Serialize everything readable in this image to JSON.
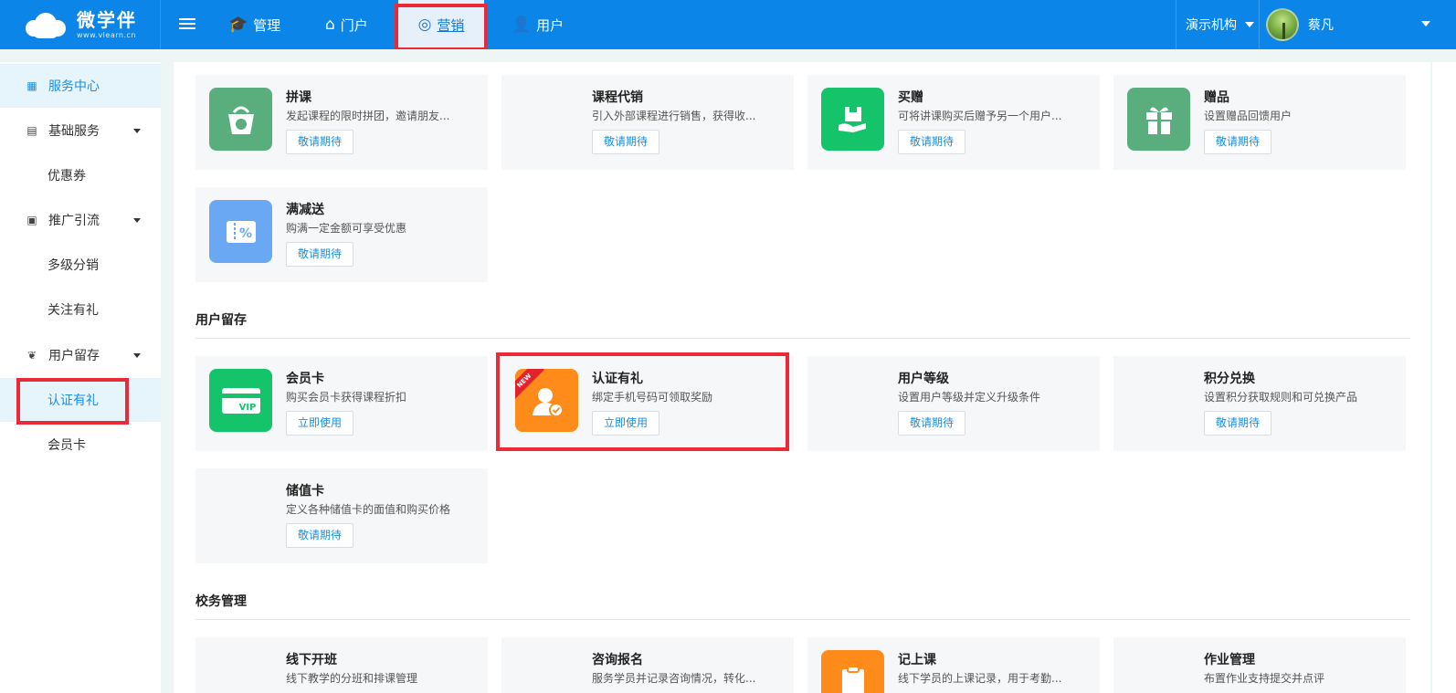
{
  "header": {
    "logo_text": "微学伴",
    "logo_sub": "www.vlearn.cn",
    "nav": [
      {
        "label": "管理",
        "icon": "graduation-cap-icon"
      },
      {
        "label": "门户",
        "icon": "home-icon"
      },
      {
        "label": "营销",
        "icon": "globe-icon",
        "active": true
      },
      {
        "label": "用户",
        "icon": "user-gear-icon"
      }
    ],
    "org": "演示机构",
    "user_name": "蔡凡"
  },
  "sidebar": {
    "items": [
      {
        "label": "服务中心",
        "icon": "grid-icon",
        "active": true
      },
      {
        "label": "基础服务",
        "icon": "book-icon"
      },
      {
        "label": "优惠券"
      },
      {
        "label": "推广引流",
        "icon": "money-icon"
      },
      {
        "label": "多级分销"
      },
      {
        "label": "关注有礼"
      },
      {
        "label": "用户留存",
        "icon": "heart-hand-icon"
      },
      {
        "label": "认证有礼",
        "active": true
      },
      {
        "label": "会员卡"
      }
    ]
  },
  "sections": {
    "retention_title": "用户留存",
    "school_title": "校务管理"
  },
  "cards": [
    {
      "title": "拼课",
      "desc": "发起课程的限时拼团，邀请朋友...",
      "button": "敬请期待",
      "icon": "bag-icon"
    },
    {
      "title": "课程代销",
      "desc": "引入外部课程进行销售，获得收...",
      "button": "敬请期待"
    },
    {
      "title": "买赠",
      "desc": "可将讲课购买后赠予另一个用户...",
      "button": "敬请期待",
      "icon": "gift-hand-icon"
    },
    {
      "title": "赠品",
      "desc": "设置赠品回馈用户",
      "button": "敬请期待",
      "icon": "gift-icon"
    },
    {
      "title": "满减送",
      "desc": "购满一定金额可享受优惠",
      "button": "敬请期待",
      "icon": "percent-coupon-icon"
    },
    {
      "title": "会员卡",
      "desc": "购买会员卡获得课程折扣",
      "button": "立即使用",
      "icon": "vip-card-icon"
    },
    {
      "title": "认证有礼",
      "desc": "绑定手机号码可领取奖励",
      "button": "立即使用",
      "icon": "user-check-icon",
      "badge": "NEW"
    },
    {
      "title": "用户等级",
      "desc": "设置用户等级并定义升级条件",
      "button": "敬请期待"
    },
    {
      "title": "积分兑换",
      "desc": "设置积分获取规则和可兑换产品",
      "button": "敬请期待"
    },
    {
      "title": "储值卡",
      "desc": "定义各种储值卡的面值和购买价格",
      "button": "敬请期待"
    },
    {
      "title": "线下开班",
      "desc": "线下教学的分班和排课管理"
    },
    {
      "title": "咨询报名",
      "desc": "服务学员并记录咨询情况，转化..."
    },
    {
      "title": "记上课",
      "desc": "线下学员的上课记录，用于考勤...",
      "icon": "clipboard-icon"
    },
    {
      "title": "作业管理",
      "desc": "布置作业支持提交并点评"
    }
  ],
  "colors": {
    "header_bg": "#0b86e8",
    "accent": "#1a8fe3",
    "highlight": "#ea2a36",
    "icon_green": "#5aad7d",
    "icon_bright_green": "#14c36a",
    "icon_blue": "#6aa8f4",
    "icon_orange": "#ff8c1a"
  }
}
